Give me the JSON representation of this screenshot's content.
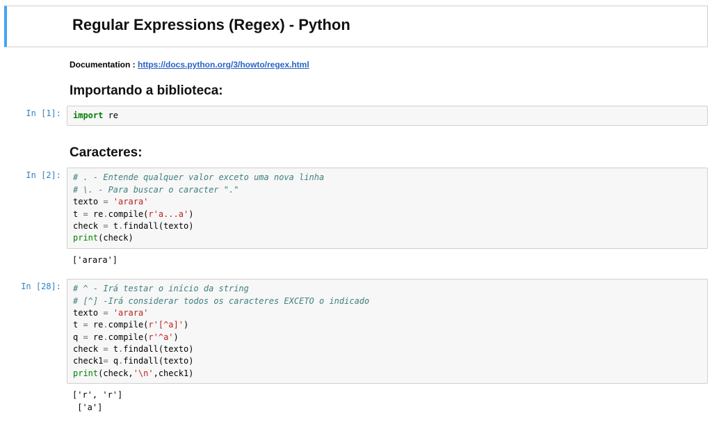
{
  "title": "Regular Expressions (Regex) - Python",
  "doc_label": "Documentation : ",
  "doc_url": "https://docs.python.org/3/howto/regex.html",
  "section_import": "Importando a biblioteca:",
  "section_chars": "Caracteres:",
  "cells": {
    "c1": {
      "prompt": "In [1]:",
      "kw1": "import",
      "mod1": " re"
    },
    "c2": {
      "prompt": "In [2]:",
      "comment1": "# . - Entende qualquer valor exceto uma nova linha",
      "comment2": "# \\. - Para buscar o caracter \".\"",
      "line3_a": "texto ",
      "line3_b": "=",
      "line3_c": " 'arara'",
      "line4_a": "t ",
      "line4_b": "=",
      "line4_c": " re",
      "line4_d": ".",
      "line4_e": "compile(",
      "line4_f": "r'a...a'",
      "line4_g": ")",
      "line5_a": "check ",
      "line5_b": "=",
      "line5_c": " t",
      "line5_d": ".",
      "line5_e": "findall(texto)",
      "line6_a": "print",
      "line6_b": "(check)",
      "output": "['arara']"
    },
    "c3": {
      "prompt": "In [28]:",
      "comment1": "# ^ - Irá testar o início da string",
      "comment2": "# [^] -Irá considerar todos os caracteres EXCETO o indicado",
      "l3_a": "texto ",
      "l3_b": "=",
      "l3_c": " 'arara'",
      "l4_a": "t ",
      "l4_b": "=",
      "l4_c": " re",
      "l4_d": ".",
      "l4_e": "compile(",
      "l4_f": "r'[^a]'",
      "l4_g": ")",
      "l5_a": "q ",
      "l5_b": "=",
      "l5_c": " re",
      "l5_d": ".",
      "l5_e": "compile(",
      "l5_f": "r'^a'",
      "l5_g": ")",
      "l6_a": "check ",
      "l6_b": "=",
      "l6_c": " t",
      "l6_d": ".",
      "l6_e": "findall(texto)",
      "l7_a": "check1",
      "l7_b": "=",
      "l7_c": " q",
      "l7_d": ".",
      "l7_e": "findall(texto)",
      "l8_a": "print",
      "l8_b": "(check,",
      "l8_c": "'\\n'",
      "l8_d": ",check1)",
      "output": "['r', 'r']\n ['a']"
    }
  }
}
